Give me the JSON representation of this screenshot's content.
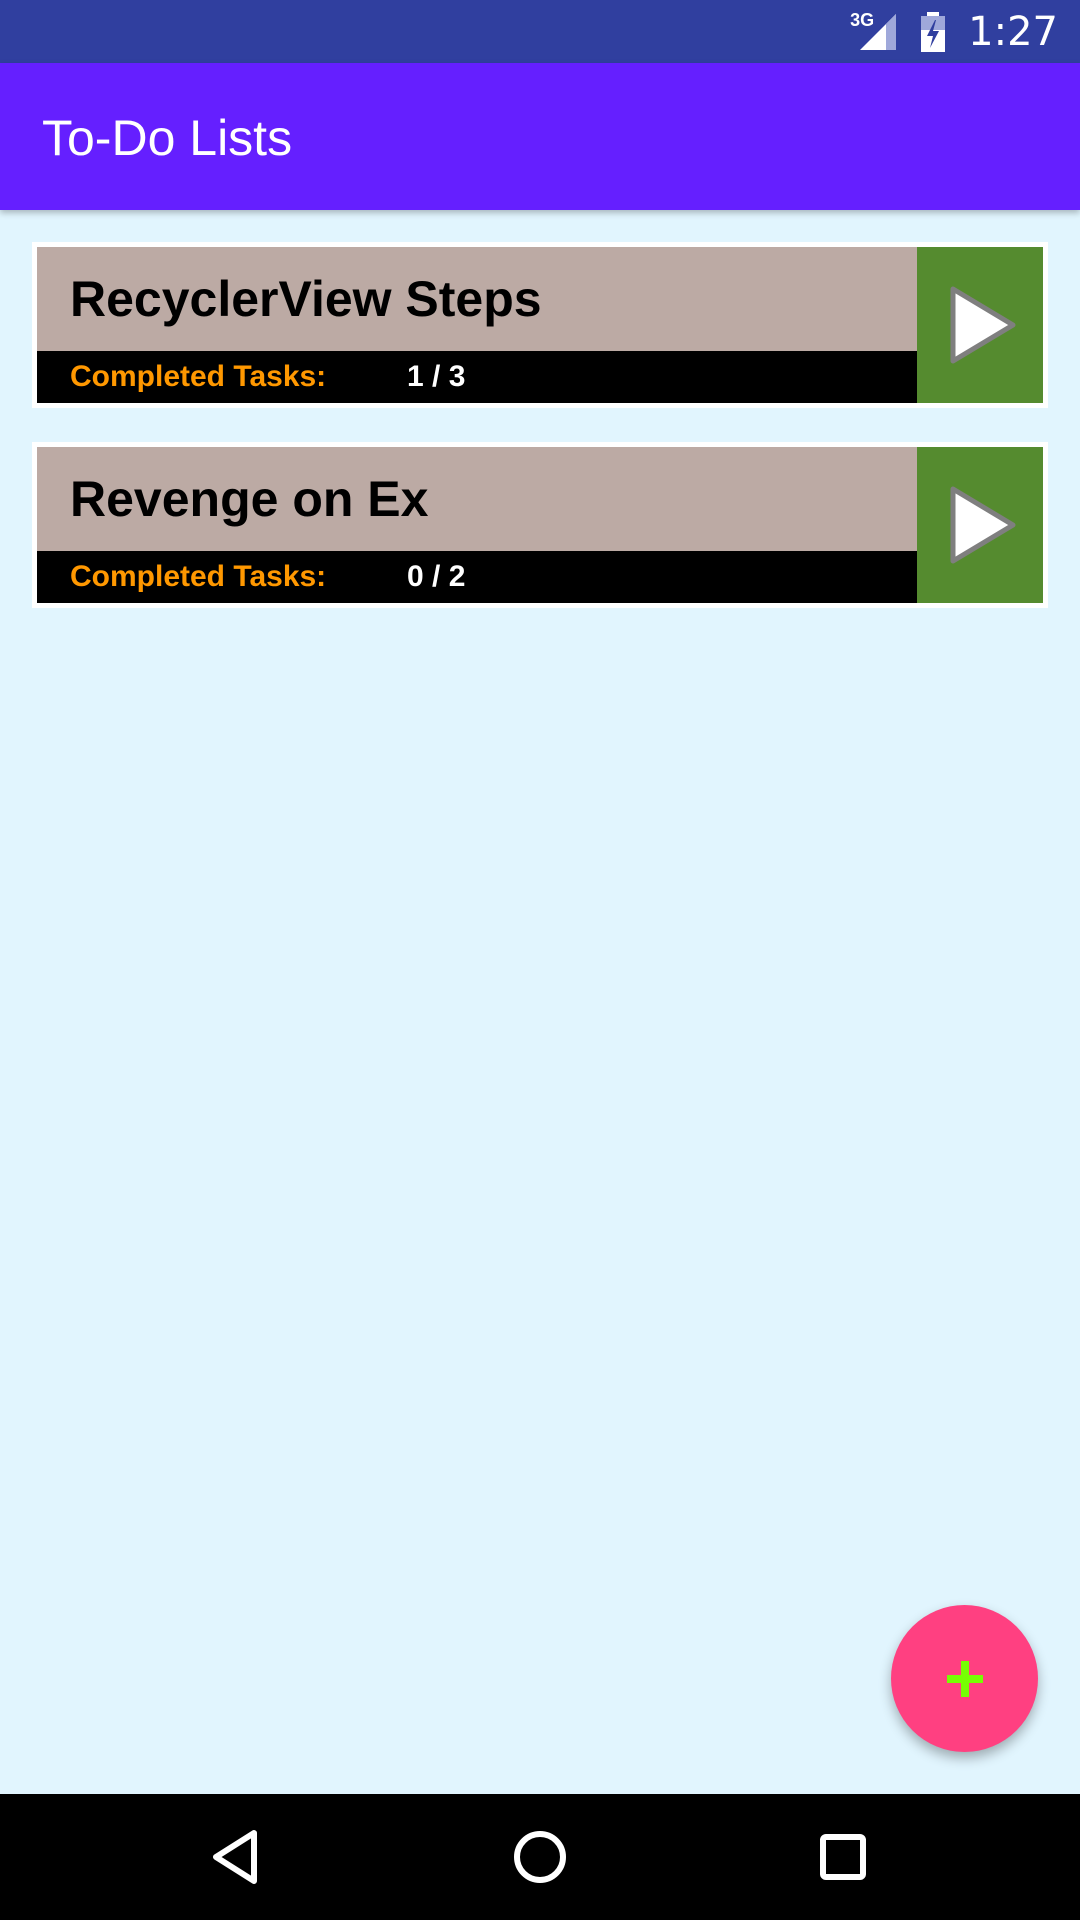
{
  "status_bar": {
    "network": "3G",
    "time": "1:27"
  },
  "app_bar": {
    "title": "To-Do Lists"
  },
  "lists": [
    {
      "name": "RecyclerView Steps",
      "completed_label": "Completed Tasks:",
      "progress": "1 / 3"
    },
    {
      "name": "Revenge on Ex",
      "completed_label": "Completed Tasks:",
      "progress": "0 / 2"
    }
  ],
  "colors": {
    "status_bar": "#303f9f",
    "app_bar": "#651fff",
    "background": "#e1f5fe",
    "card_title_bg": "#bcaaa4",
    "card_stats_bg": "#000000",
    "stats_label": "#ff9800",
    "play_button": "#558b2f",
    "fab": "#ff4081",
    "fab_icon": "#76ff03"
  },
  "icons": {
    "card_action": "play-icon",
    "fab": "plus-icon",
    "nav": [
      "back-icon",
      "home-icon",
      "recents-icon"
    ]
  }
}
